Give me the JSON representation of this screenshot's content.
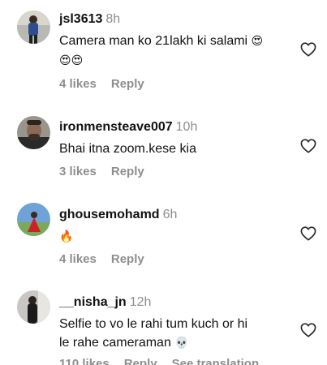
{
  "comments": [
    {
      "username": "jsl3613",
      "time": "8h",
      "text": "Camera man ko 21lakh ki salami",
      "emoji_inline": "😍",
      "emoji_line2": "😍😍",
      "likes": "4 likes",
      "reply": "Reply"
    },
    {
      "username": "ironmensteave007",
      "time": "10h",
      "text": "Bhai itna zoom.kese kia",
      "likes": "3 likes",
      "reply": "Reply"
    },
    {
      "username": "ghousemohamd",
      "time": "6h",
      "emoji_text": "🔥",
      "likes": "4 likes",
      "reply": "Reply"
    },
    {
      "username": "__nisha_jn",
      "time": "12h",
      "text_line1": "Selfie to vo le rahi tum kuch or hi",
      "text_line2": "le rahe cameraman",
      "emoji_inline": "💀",
      "likes": "110 likes",
      "reply": "Reply",
      "see_translation": "See translation"
    }
  ],
  "icons": {
    "like": "heart-outline-icon",
    "avatar": "profile-avatar"
  },
  "colors": {
    "text": "#111111",
    "muted": "#8e8e8e",
    "background": "#ffffff"
  }
}
